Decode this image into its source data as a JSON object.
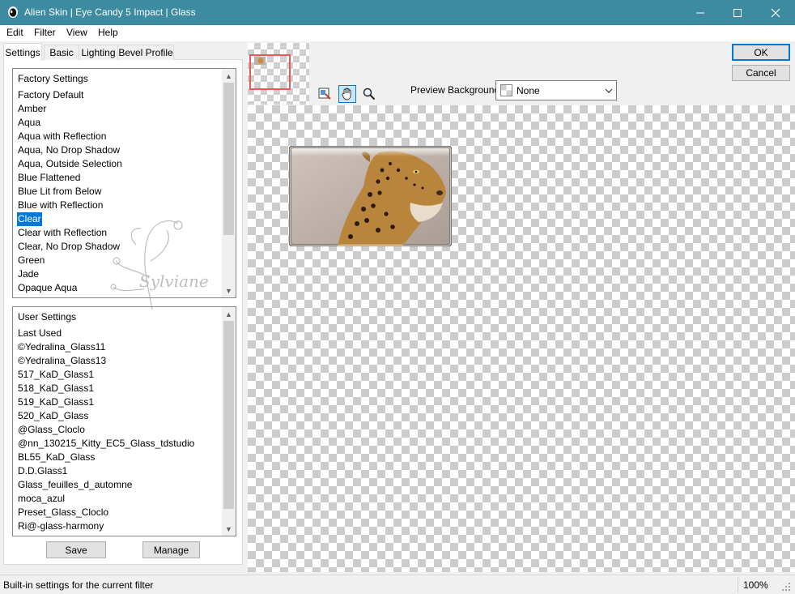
{
  "window": {
    "title": "Alien Skin | Eye Candy 5 Impact | Glass",
    "title_bar_color": "#3d8ba1",
    "controls": {
      "minimize": "minimize-icon",
      "maximize": "maximize-icon",
      "close": "close-icon"
    }
  },
  "menu": {
    "items": [
      "Edit",
      "Filter",
      "View",
      "Help"
    ]
  },
  "tabs": {
    "items": [
      "Settings",
      "Basic",
      "Lighting",
      "Bevel Profile"
    ],
    "active": "Settings"
  },
  "factory_settings": {
    "header": "Factory Settings",
    "items": [
      "Factory Default",
      "Amber",
      "Aqua",
      "Aqua with Reflection",
      "Aqua, No Drop Shadow",
      "Aqua, Outside Selection",
      "Blue Flattened",
      "Blue Lit from Below",
      "Blue with Reflection",
      "Clear",
      "Clear with Reflection",
      "Clear, No Drop Shadow",
      "Green",
      "Jade",
      "Opaque Aqua"
    ],
    "selected": "Clear"
  },
  "user_settings": {
    "header": "User Settings",
    "items": [
      "Last Used",
      "©Yedralina_Glass11",
      "©Yedralina_Glass13",
      "517_KaD_Glass1",
      "518_KaD_Glass1",
      "519_KaD_Glass1",
      "520_KaD_Glass",
      "@Glass_Cloclo",
      "@nn_130215_Kitty_EC5_Glass_tdstudio",
      "BL55_KaD_Glass",
      "D.D.Glass1",
      "Glass_feuilles_d_automne",
      "moca_azul",
      "Preset_Glass_Cloclo",
      "Ri@-glass-harmony"
    ]
  },
  "buttons": {
    "save": "Save",
    "manage": "Manage",
    "ok": "OK",
    "cancel": "Cancel"
  },
  "watermark": {
    "text": "Sylviane"
  },
  "preview": {
    "background_label": "Preview Background:",
    "background_value": "None",
    "tools": [
      "pan-preview-icon",
      "hand-icon",
      "zoom-icon"
    ],
    "active_tool": "hand-icon"
  },
  "status": {
    "text": "Built-in settings for the current filter",
    "zoom": "100%"
  },
  "colors": {
    "selection": "#0078d7",
    "thumb_frame": "#e8595a",
    "accent": "#0078d7"
  }
}
